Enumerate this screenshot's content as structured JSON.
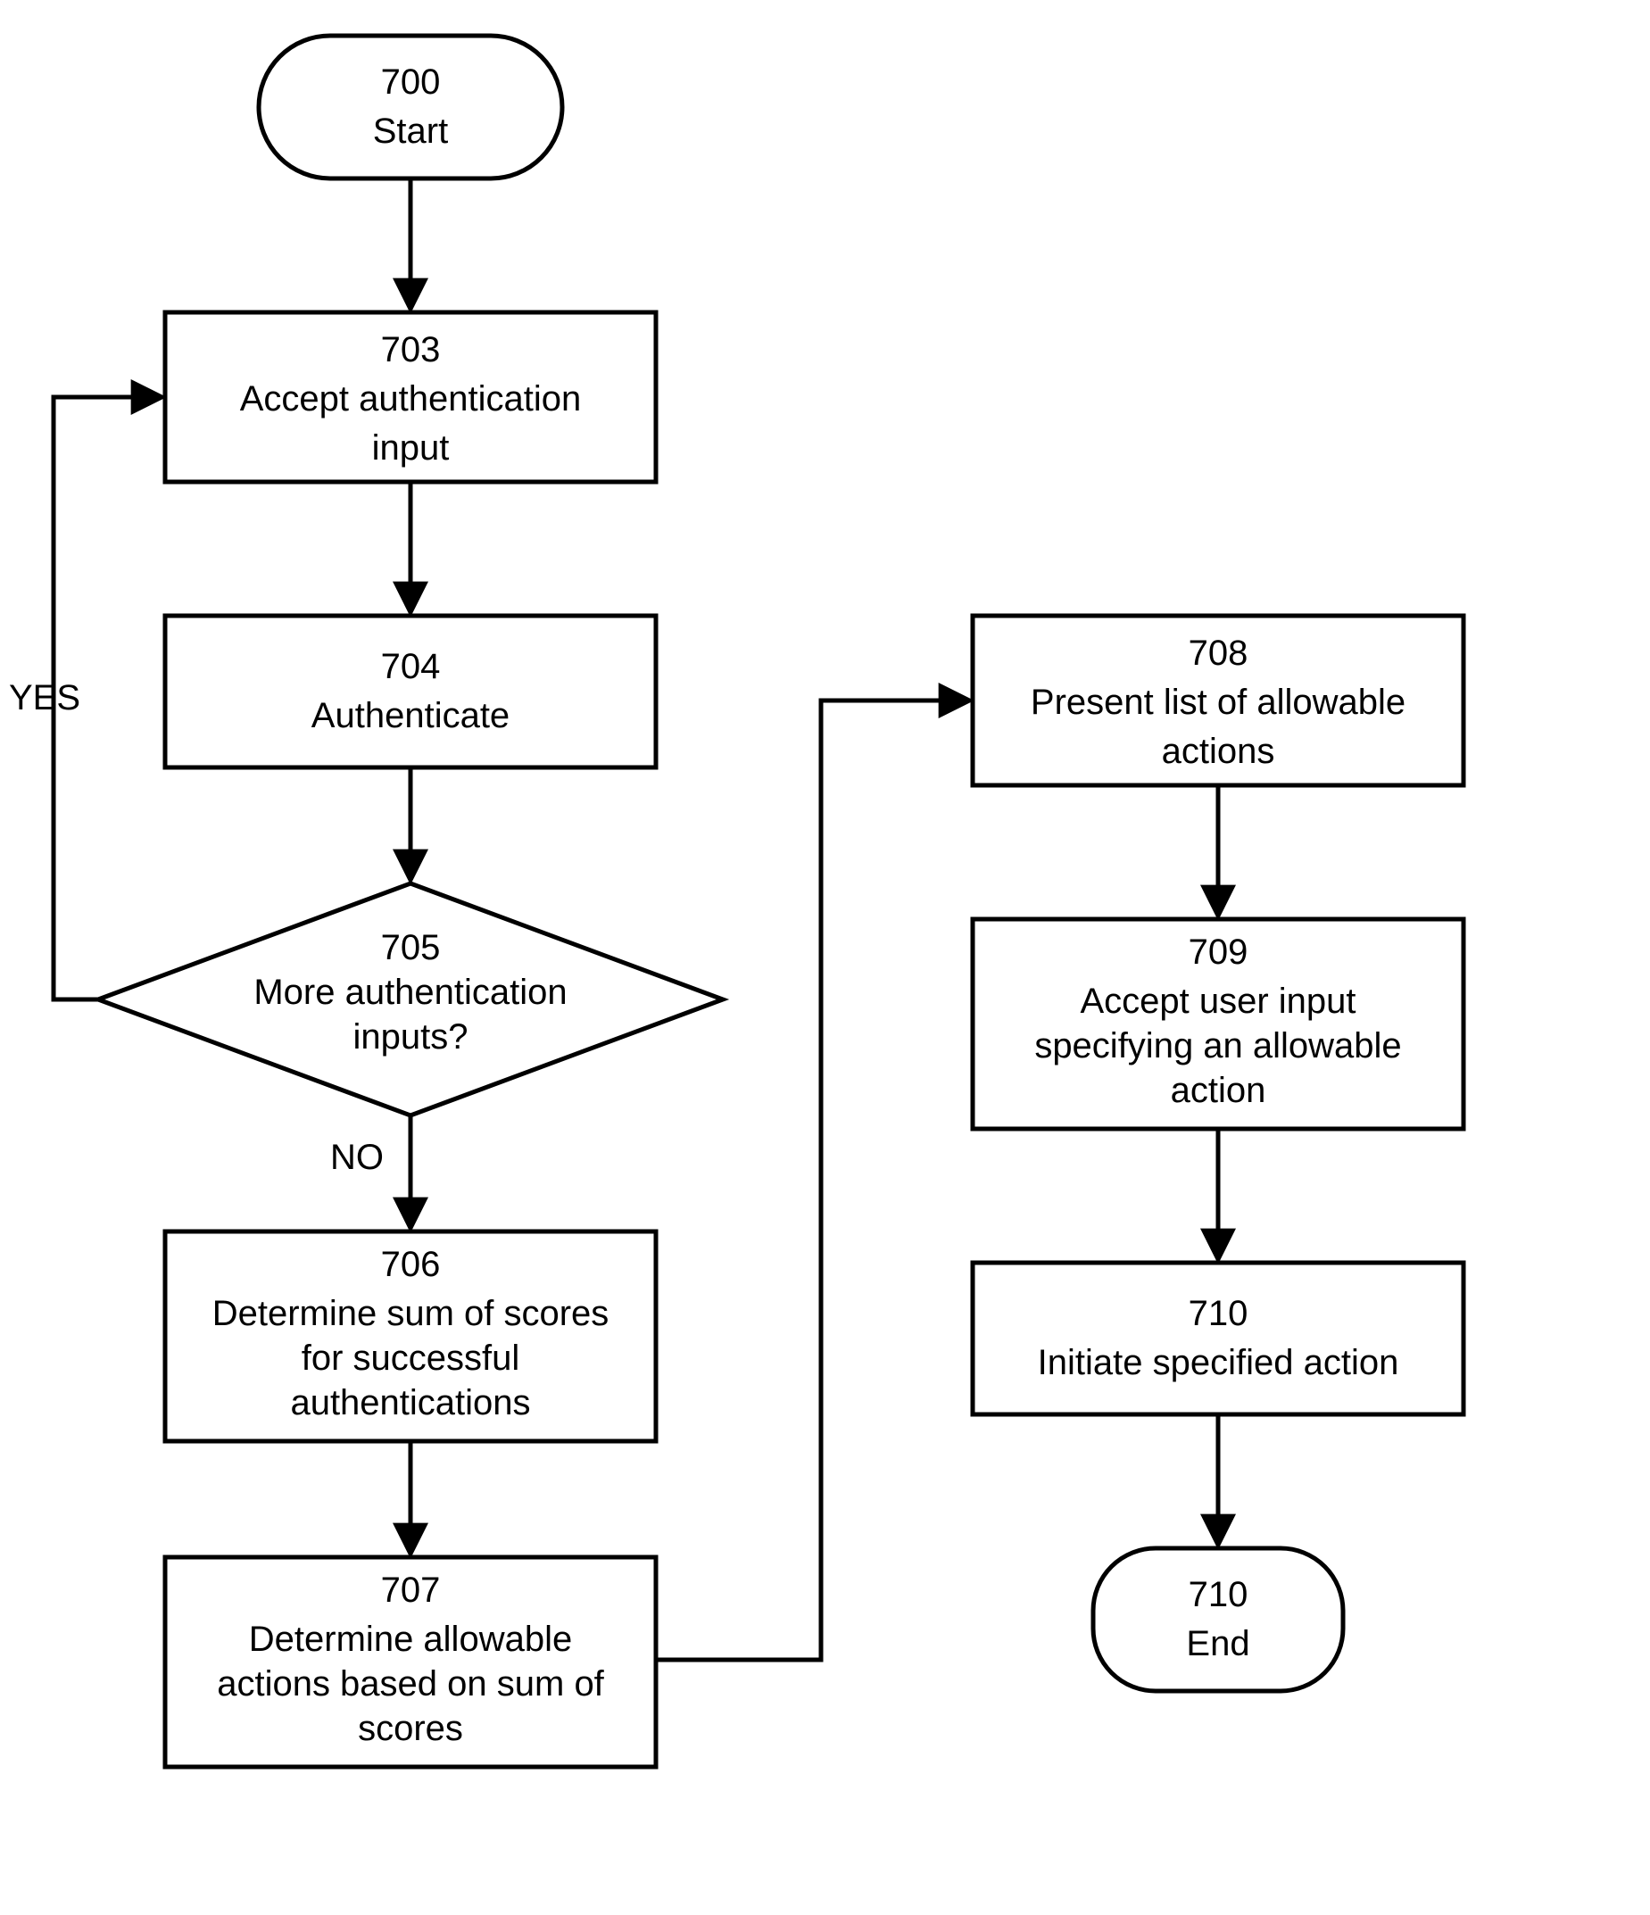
{
  "nodes": {
    "start": {
      "num": "700",
      "label": "Start"
    },
    "n703": {
      "num": "703",
      "label1": "Accept authentication",
      "label2": "input"
    },
    "n704": {
      "num": "704",
      "label1": "Authenticate"
    },
    "n705": {
      "num": "705",
      "label1": "More authentication",
      "label2": "inputs?"
    },
    "n706": {
      "num": "706",
      "label1": "Determine sum of scores",
      "label2": "for successful",
      "label3": "authentications"
    },
    "n707": {
      "num": "707",
      "label1": "Determine allowable",
      "label2": "actions based on sum of",
      "label3": "scores"
    },
    "n708": {
      "num": "708",
      "label1": "Present list of allowable",
      "label2": "actions"
    },
    "n709": {
      "num": "709",
      "label1": "Accept user input",
      "label2": "specifying an allowable",
      "label3": "action"
    },
    "n710": {
      "num": "710",
      "label1": "Initiate specified action"
    },
    "end": {
      "num": "710",
      "label": "End"
    }
  },
  "edges": {
    "yes": "YES",
    "no": "NO"
  }
}
